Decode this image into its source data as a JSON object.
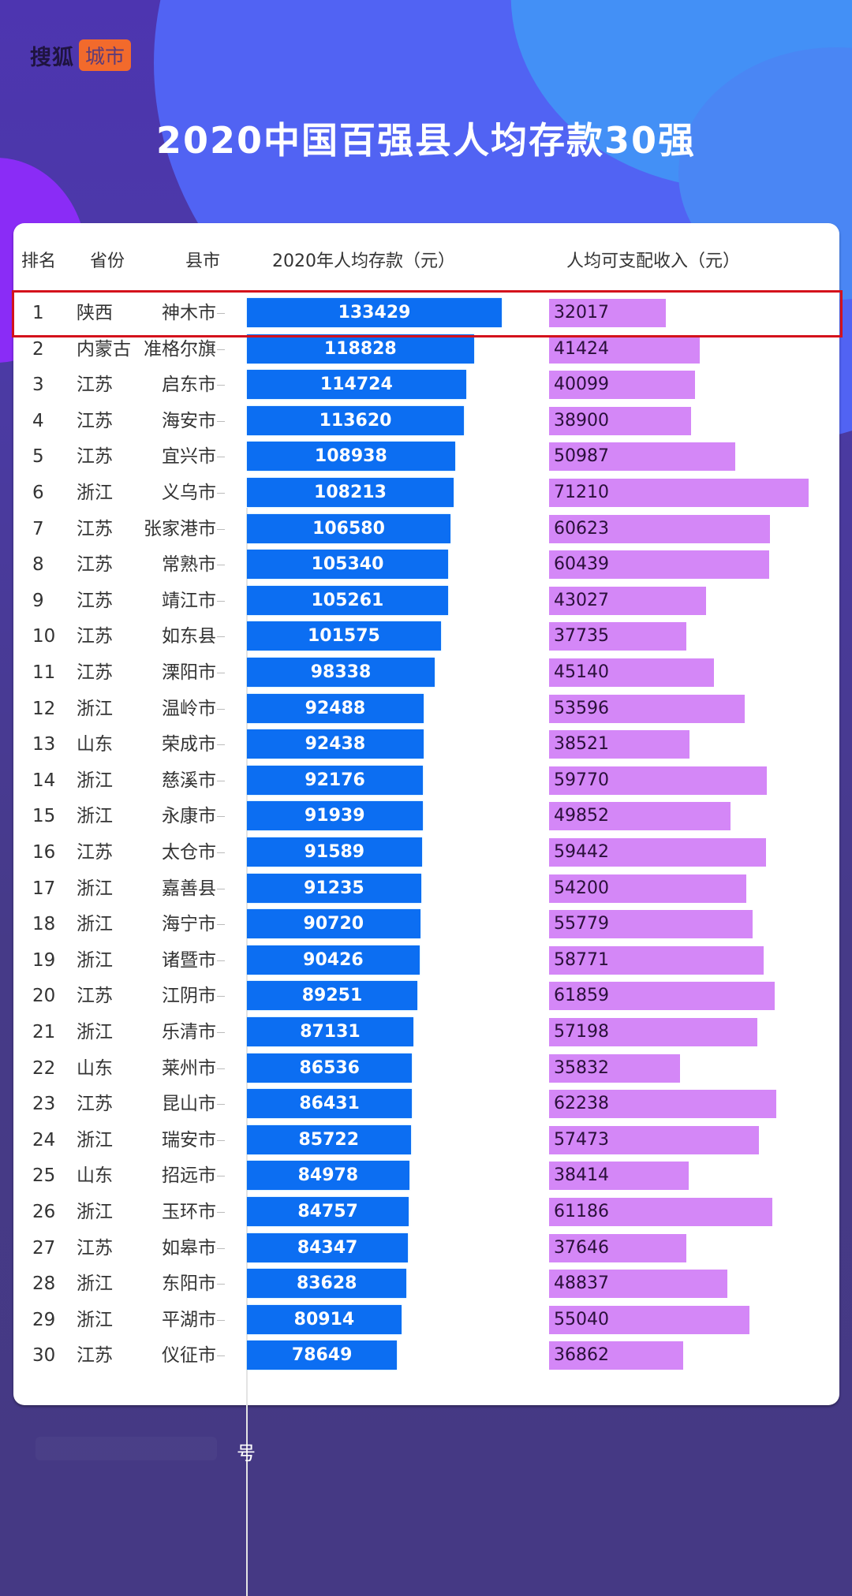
{
  "branding": {
    "logo_text": "搜狐",
    "logo_badge": "城市"
  },
  "colors": {
    "deposit_bar": "#0c6ef2",
    "income_bar": "#d487f7",
    "highlight_border": "#d4121c"
  },
  "chart_data": {
    "type": "bar",
    "orientation": "horizontal",
    "title": "2020中国百强县人均存款30强",
    "columns": [
      "排名",
      "省份",
      "县市",
      "2020年人均存款（元）",
      "人均可支配收入（元）"
    ],
    "highlighted_rank": 1,
    "rows": [
      {
        "rank": "1",
        "province": "陕西",
        "county": "神木市",
        "deposit": 133429,
        "income": 32017
      },
      {
        "rank": "2",
        "province": "内蒙古",
        "county": "准格尔旗",
        "deposit": 118828,
        "income": 41424
      },
      {
        "rank": "3",
        "province": "江苏",
        "county": "启东市",
        "deposit": 114724,
        "income": 40099
      },
      {
        "rank": "4",
        "province": "江苏",
        "county": "海安市",
        "deposit": 113620,
        "income": 38900
      },
      {
        "rank": "5",
        "province": "江苏",
        "county": "宜兴市",
        "deposit": 108938,
        "income": 50987
      },
      {
        "rank": "6",
        "province": "浙江",
        "county": "义乌市",
        "deposit": 108213,
        "income": 71210
      },
      {
        "rank": "7",
        "province": "江苏",
        "county": "张家港市",
        "deposit": 106580,
        "income": 60623
      },
      {
        "rank": "8",
        "province": "江苏",
        "county": "常熟市",
        "deposit": 105340,
        "income": 60439
      },
      {
        "rank": "9",
        "province": "江苏",
        "county": "靖江市",
        "deposit": 105261,
        "income": 43027
      },
      {
        "rank": "10",
        "province": "江苏",
        "county": "如东县",
        "deposit": 101575,
        "income": 37735
      },
      {
        "rank": "11",
        "province": "江苏",
        "county": "溧阳市",
        "deposit": 98338,
        "income": 45140
      },
      {
        "rank": "12",
        "province": "浙江",
        "county": "温岭市",
        "deposit": 92488,
        "income": 53596
      },
      {
        "rank": "13",
        "province": "山东",
        "county": "荣成市",
        "deposit": 92438,
        "income": 38521
      },
      {
        "rank": "14",
        "province": "浙江",
        "county": "慈溪市",
        "deposit": 92176,
        "income": 59770
      },
      {
        "rank": "15",
        "province": "浙江",
        "county": "永康市",
        "deposit": 91939,
        "income": 49852
      },
      {
        "rank": "16",
        "province": "江苏",
        "county": "太仓市",
        "deposit": 91589,
        "income": 59442
      },
      {
        "rank": "17",
        "province": "浙江",
        "county": "嘉善县",
        "deposit": 91235,
        "income": 54200
      },
      {
        "rank": "18",
        "province": "浙江",
        "county": "海宁市",
        "deposit": 90720,
        "income": 55779
      },
      {
        "rank": "19",
        "province": "浙江",
        "county": "诸暨市",
        "deposit": 90426,
        "income": 58771
      },
      {
        "rank": "20",
        "province": "江苏",
        "county": "江阴市",
        "deposit": 89251,
        "income": 61859
      },
      {
        "rank": "21",
        "province": "浙江",
        "county": "乐清市",
        "deposit": 87131,
        "income": 57198
      },
      {
        "rank": "22",
        "province": "山东",
        "county": "莱州市",
        "deposit": 86536,
        "income": 35832
      },
      {
        "rank": "23",
        "province": "江苏",
        "county": "昆山市",
        "deposit": 86431,
        "income": 62238
      },
      {
        "rank": "24",
        "province": "浙江",
        "county": "瑞安市",
        "deposit": 85722,
        "income": 57473
      },
      {
        "rank": "25",
        "province": "山东",
        "county": "招远市",
        "deposit": 84978,
        "income": 38414
      },
      {
        "rank": "26",
        "province": "浙江",
        "county": "玉环市",
        "deposit": 84757,
        "income": 61186
      },
      {
        "rank": "27",
        "province": "江苏",
        "county": "如皋市",
        "deposit": 84347,
        "income": 37646
      },
      {
        "rank": "28",
        "province": "浙江",
        "county": "东阳市",
        "deposit": 83628,
        "income": 48837
      },
      {
        "rank": "29",
        "province": "浙江",
        "county": "平湖市",
        "deposit": 80914,
        "income": 55040
      },
      {
        "rank": "30",
        "province": "江苏",
        "county": "仪征市",
        "deposit": 78649,
        "income": 36862
      }
    ]
  },
  "footer": {
    "text": "号"
  }
}
